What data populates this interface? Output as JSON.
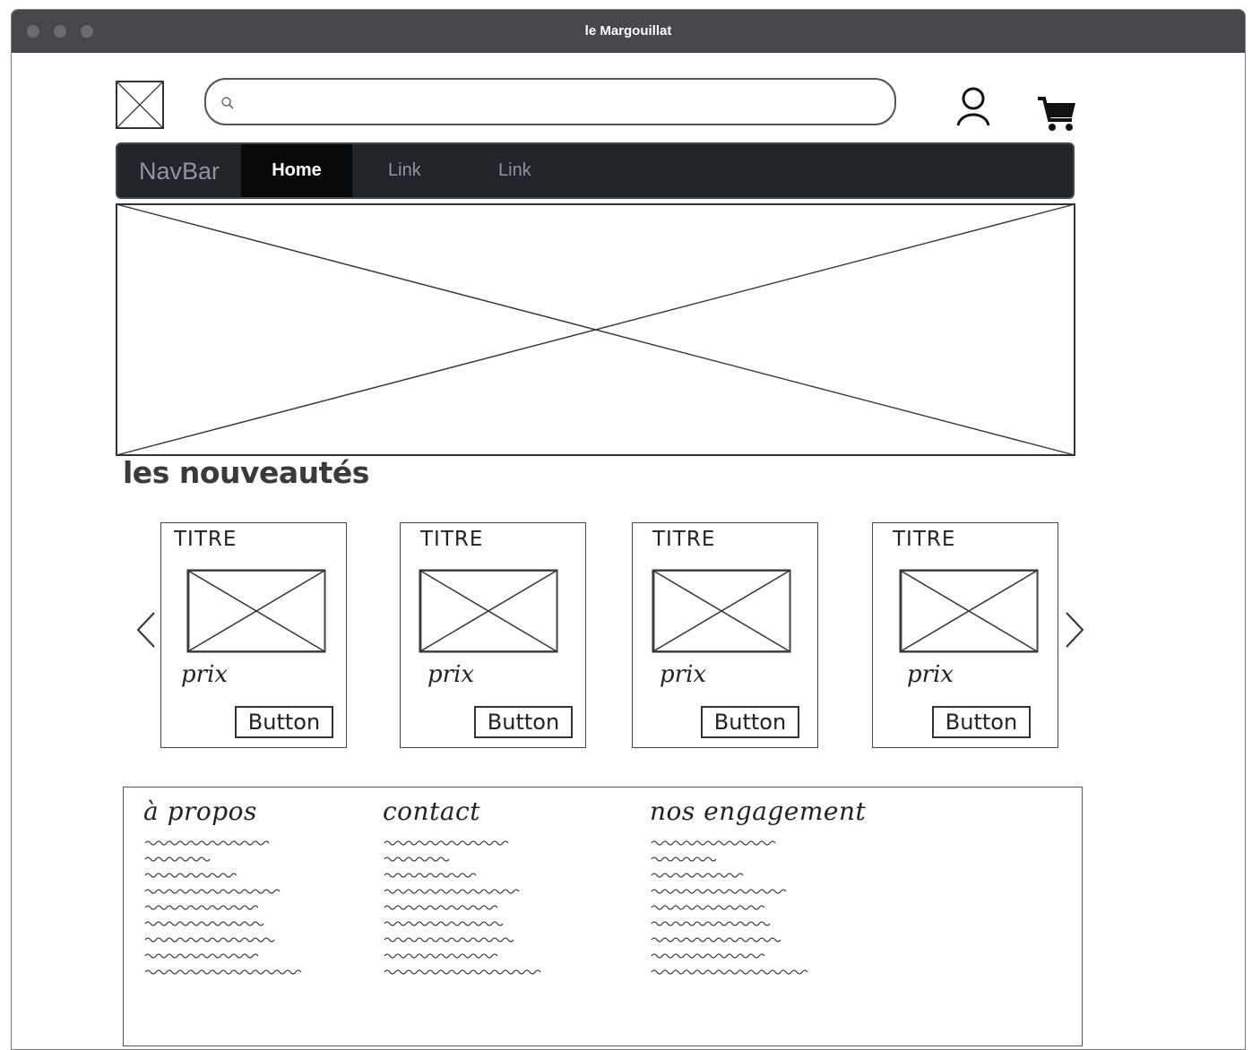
{
  "window": {
    "title": "le Margouillat"
  },
  "header": {
    "search_placeholder": "",
    "icons": {
      "logo": "image-placeholder-icon",
      "search": "search-icon",
      "user": "user-icon",
      "cart": "cart-icon"
    }
  },
  "navbar": {
    "brand": "NavBar",
    "items": [
      {
        "label": "Home",
        "active": true
      },
      {
        "label": "Link",
        "active": false
      },
      {
        "label": "Link",
        "active": false
      }
    ],
    "colors": {
      "background": "#212529",
      "active_background": "#07080a",
      "text": "#8e959c",
      "active_text": "#ffffff"
    }
  },
  "hero": {
    "icon": "image-placeholder-icon"
  },
  "new_products": {
    "title": "les nouveautés",
    "cards": [
      {
        "title": "TITRE",
        "price": "prix",
        "button": "Button"
      },
      {
        "title": "TITRE",
        "price": "prix",
        "button": "Button"
      },
      {
        "title": "TITRE",
        "price": "prix",
        "button": "Button"
      },
      {
        "title": "TITRE",
        "price": "prix",
        "button": "Button"
      }
    ],
    "icons": {
      "prev": "chevron-left-icon",
      "next": "chevron-right-icon"
    }
  },
  "footer": {
    "columns": [
      {
        "heading": "à propos"
      },
      {
        "heading": "contact"
      },
      {
        "heading": "nos engagement"
      }
    ]
  }
}
